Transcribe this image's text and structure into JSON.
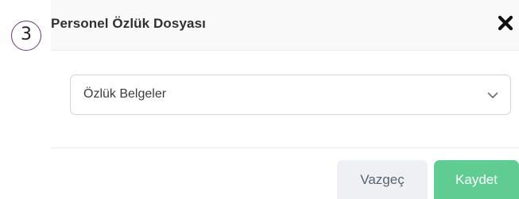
{
  "step_badge": "3",
  "modal": {
    "title": "Personel Özlük Dosyası",
    "close_icon": "close-icon"
  },
  "select": {
    "value": "Özlük Belgeler",
    "icon": "chevron-down-icon"
  },
  "footer": {
    "cancel_label": "Vazgeç",
    "save_label": "Kaydet"
  },
  "colors": {
    "save_button": "#5fcc91",
    "cancel_button": "#eef0f3",
    "badge_border": "#6b3a75"
  }
}
